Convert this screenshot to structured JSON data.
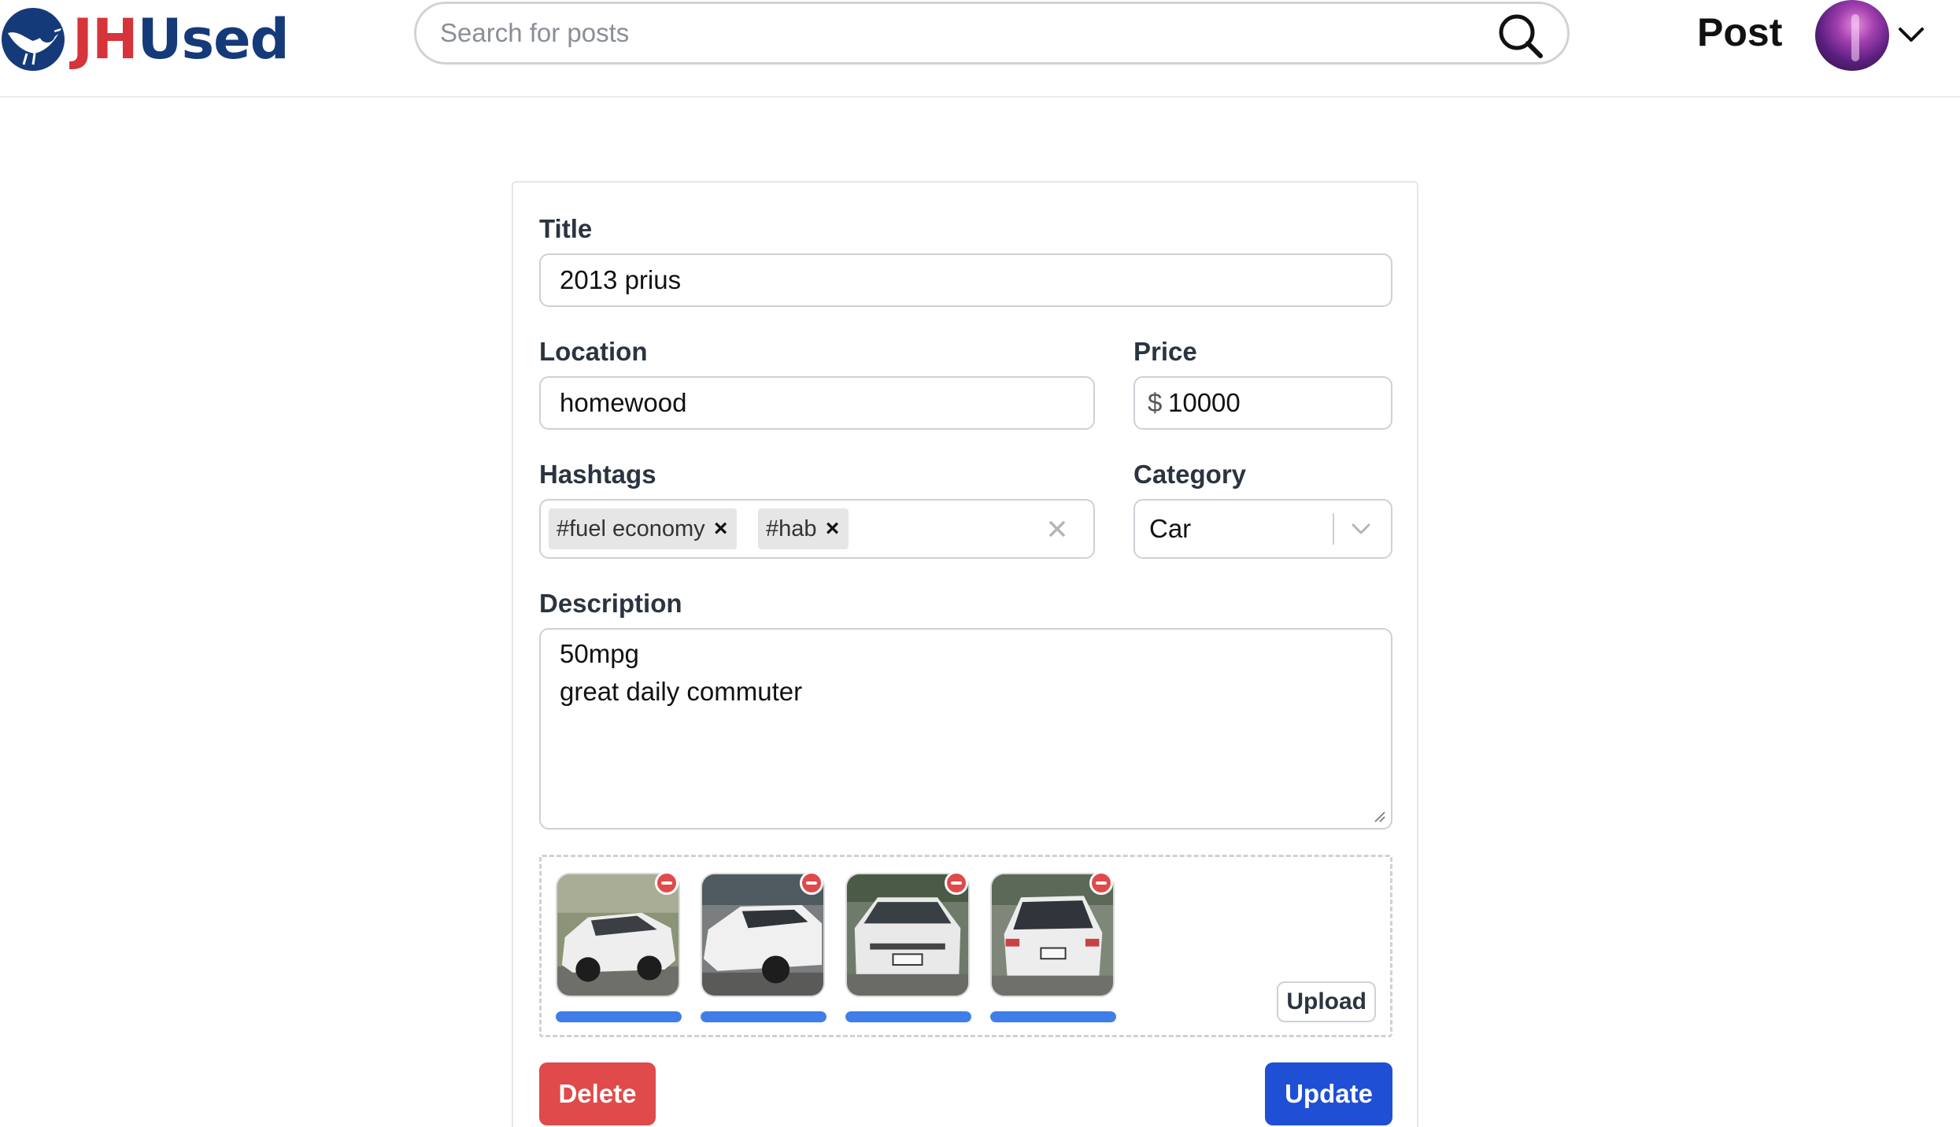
{
  "header": {
    "logo": {
      "part1": "JH",
      "part2": "Used",
      "brand_red": "#d6333a",
      "brand_blue": "#153a7a"
    },
    "search": {
      "placeholder": "Search for posts",
      "value": "",
      "icon": "search-icon"
    },
    "post_link": "Post",
    "avatar_icon": "avatar",
    "menu_icon": "chevron-down-icon"
  },
  "form": {
    "title": {
      "label": "Title",
      "value": "2013 prius"
    },
    "location": {
      "label": "Location",
      "value": "homewood"
    },
    "price": {
      "label": "Price",
      "prefix": "$",
      "value": "10000"
    },
    "hashtags": {
      "label": "Hashtags",
      "tags": [
        {
          "text": "#fuel economy"
        },
        {
          "text": "#hab"
        }
      ],
      "remove_glyph": "×",
      "clear_icon": "clear-icon"
    },
    "category": {
      "label": "Category",
      "value": "Car"
    },
    "description": {
      "label": "Description",
      "lines": [
        "50mpg",
        "great daily commuter"
      ]
    },
    "images": {
      "items": [
        {
          "name": "car-photo-1",
          "progress": 1.0
        },
        {
          "name": "car-photo-2",
          "progress": 1.0
        },
        {
          "name": "car-photo-3",
          "progress": 1.0
        },
        {
          "name": "car-photo-4",
          "progress": 1.0
        }
      ],
      "upload_label": "Upload",
      "progress_color": "#3f7ee8"
    },
    "delete_label": "Delete",
    "update_label": "Update",
    "delete_color": "#e04a4a",
    "update_color": "#1f4fd4"
  }
}
